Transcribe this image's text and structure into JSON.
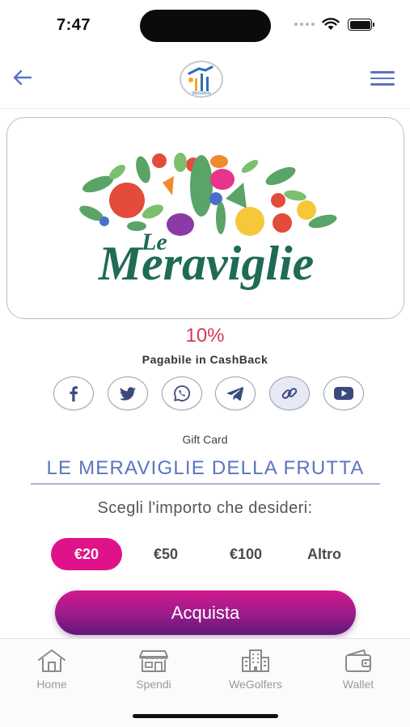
{
  "status_bar": {
    "time": "7:47"
  },
  "header": {
    "logo_text": "WeGolfers"
  },
  "brand": {
    "logo_word_small": "Le",
    "logo_word_large": "Meraviglie",
    "colors": {
      "brand_green": "#1f6b56",
      "leaf_green": "#5aa468",
      "accent_red": "#e34b3b",
      "accent_yellow": "#f5c83a",
      "accent_purple": "#8b3aa6"
    }
  },
  "offer": {
    "percent": "10%",
    "cashback_label": "Pagabile in CashBack"
  },
  "share": {
    "buttons": [
      {
        "icon": "facebook-icon"
      },
      {
        "icon": "twitter-icon"
      },
      {
        "icon": "whatsapp-icon"
      },
      {
        "icon": "telegram-icon"
      },
      {
        "icon": "link-icon"
      },
      {
        "icon": "youtube-icon"
      }
    ]
  },
  "product": {
    "type_label": "Gift Card",
    "title": "LE MERAVIGLIE DELLA FRUTTA",
    "amount_prompt": "Scegli l'importo che desideri:",
    "amounts": [
      {
        "label": "€20",
        "selected": true
      },
      {
        "label": "€50",
        "selected": false
      },
      {
        "label": "€100",
        "selected": false
      },
      {
        "label": "Altro",
        "selected": false
      }
    ],
    "buy_label": "Acquista"
  },
  "tab_bar": {
    "tabs": [
      {
        "label": "Home",
        "icon": "home-icon"
      },
      {
        "label": "Spendi",
        "icon": "store-icon"
      },
      {
        "label": "WeGolfers",
        "icon": "buildings-icon"
      },
      {
        "label": "Wallet",
        "icon": "wallet-icon"
      }
    ]
  },
  "colors": {
    "accent_blue": "#5b73c2",
    "accent_magenta": "#e0128a",
    "percent_red": "#d9365a",
    "buy_gradient_start": "#d01a8d",
    "buy_gradient_end": "#5e1878"
  }
}
